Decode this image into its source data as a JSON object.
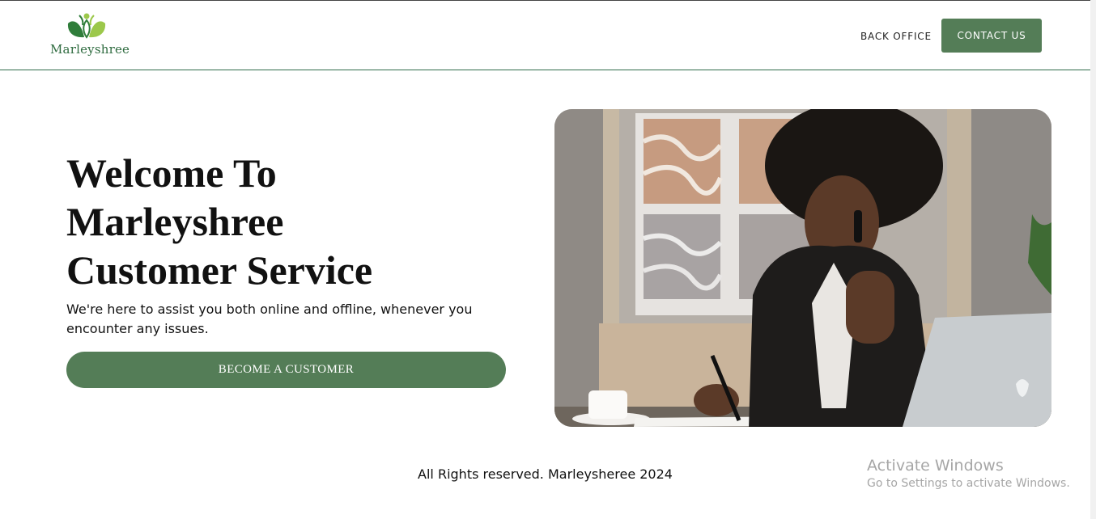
{
  "brand": {
    "name": "Marleyshree",
    "primary_color": "#547d57",
    "leaf_colors": [
      "#2f7d3a",
      "#9cc84b"
    ]
  },
  "nav": {
    "back_office": "BACK OFFICE",
    "contact_us": "CONTACT US"
  },
  "hero": {
    "title_lines": [
      "Welcome To",
      "Marleyshree",
      "Customer Service"
    ],
    "subtitle": "We're here to assist you both online and offline, whenever you encounter any issues.",
    "cta": "BECOME A CUSTOMER"
  },
  "footer": {
    "copyright": "All Rights reserved. Marleysheree 2024"
  },
  "watermark": {
    "title": "Activate Windows",
    "subtitle": "Go to Settings to activate Windows."
  }
}
